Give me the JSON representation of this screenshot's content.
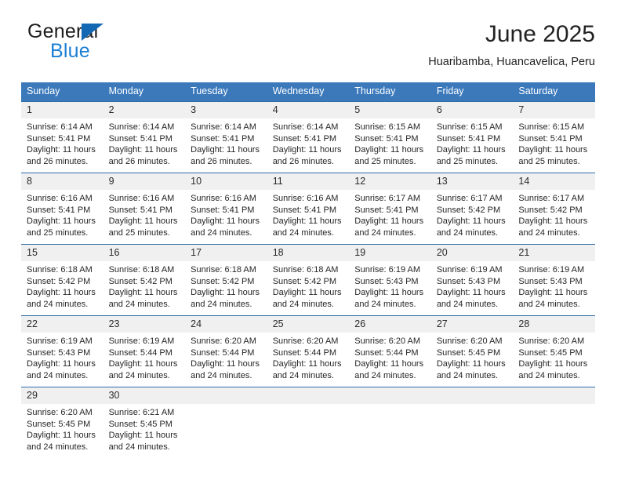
{
  "brand": {
    "name_top": "General",
    "name_bottom": "Blue",
    "triangle_color": "#1268b3",
    "blue_color": "#1b7fd4"
  },
  "header": {
    "title": "June 2025",
    "subtitle": "Huaribamba, Huancavelica, Peru"
  },
  "theme": {
    "header_bg": "#3b79bb",
    "header_text": "#ffffff",
    "daynum_bg": "#f0f0f0",
    "week_border": "#2e6da4"
  },
  "weekdays": [
    "Sunday",
    "Monday",
    "Tuesday",
    "Wednesday",
    "Thursday",
    "Friday",
    "Saturday"
  ],
  "weeks": [
    [
      {
        "day": "1",
        "sunrise": "Sunrise: 6:14 AM",
        "sunset": "Sunset: 5:41 PM",
        "daylight": "Daylight: 11 hours and 26 minutes."
      },
      {
        "day": "2",
        "sunrise": "Sunrise: 6:14 AM",
        "sunset": "Sunset: 5:41 PM",
        "daylight": "Daylight: 11 hours and 26 minutes."
      },
      {
        "day": "3",
        "sunrise": "Sunrise: 6:14 AM",
        "sunset": "Sunset: 5:41 PM",
        "daylight": "Daylight: 11 hours and 26 minutes."
      },
      {
        "day": "4",
        "sunrise": "Sunrise: 6:14 AM",
        "sunset": "Sunset: 5:41 PM",
        "daylight": "Daylight: 11 hours and 26 minutes."
      },
      {
        "day": "5",
        "sunrise": "Sunrise: 6:15 AM",
        "sunset": "Sunset: 5:41 PM",
        "daylight": "Daylight: 11 hours and 25 minutes."
      },
      {
        "day": "6",
        "sunrise": "Sunrise: 6:15 AM",
        "sunset": "Sunset: 5:41 PM",
        "daylight": "Daylight: 11 hours and 25 minutes."
      },
      {
        "day": "7",
        "sunrise": "Sunrise: 6:15 AM",
        "sunset": "Sunset: 5:41 PM",
        "daylight": "Daylight: 11 hours and 25 minutes."
      }
    ],
    [
      {
        "day": "8",
        "sunrise": "Sunrise: 6:16 AM",
        "sunset": "Sunset: 5:41 PM",
        "daylight": "Daylight: 11 hours and 25 minutes."
      },
      {
        "day": "9",
        "sunrise": "Sunrise: 6:16 AM",
        "sunset": "Sunset: 5:41 PM",
        "daylight": "Daylight: 11 hours and 25 minutes."
      },
      {
        "day": "10",
        "sunrise": "Sunrise: 6:16 AM",
        "sunset": "Sunset: 5:41 PM",
        "daylight": "Daylight: 11 hours and 24 minutes."
      },
      {
        "day": "11",
        "sunrise": "Sunrise: 6:16 AM",
        "sunset": "Sunset: 5:41 PM",
        "daylight": "Daylight: 11 hours and 24 minutes."
      },
      {
        "day": "12",
        "sunrise": "Sunrise: 6:17 AM",
        "sunset": "Sunset: 5:41 PM",
        "daylight": "Daylight: 11 hours and 24 minutes."
      },
      {
        "day": "13",
        "sunrise": "Sunrise: 6:17 AM",
        "sunset": "Sunset: 5:42 PM",
        "daylight": "Daylight: 11 hours and 24 minutes."
      },
      {
        "day": "14",
        "sunrise": "Sunrise: 6:17 AM",
        "sunset": "Sunset: 5:42 PM",
        "daylight": "Daylight: 11 hours and 24 minutes."
      }
    ],
    [
      {
        "day": "15",
        "sunrise": "Sunrise: 6:18 AM",
        "sunset": "Sunset: 5:42 PM",
        "daylight": "Daylight: 11 hours and 24 minutes."
      },
      {
        "day": "16",
        "sunrise": "Sunrise: 6:18 AM",
        "sunset": "Sunset: 5:42 PM",
        "daylight": "Daylight: 11 hours and 24 minutes."
      },
      {
        "day": "17",
        "sunrise": "Sunrise: 6:18 AM",
        "sunset": "Sunset: 5:42 PM",
        "daylight": "Daylight: 11 hours and 24 minutes."
      },
      {
        "day": "18",
        "sunrise": "Sunrise: 6:18 AM",
        "sunset": "Sunset: 5:42 PM",
        "daylight": "Daylight: 11 hours and 24 minutes."
      },
      {
        "day": "19",
        "sunrise": "Sunrise: 6:19 AM",
        "sunset": "Sunset: 5:43 PM",
        "daylight": "Daylight: 11 hours and 24 minutes."
      },
      {
        "day": "20",
        "sunrise": "Sunrise: 6:19 AM",
        "sunset": "Sunset: 5:43 PM",
        "daylight": "Daylight: 11 hours and 24 minutes."
      },
      {
        "day": "21",
        "sunrise": "Sunrise: 6:19 AM",
        "sunset": "Sunset: 5:43 PM",
        "daylight": "Daylight: 11 hours and 24 minutes."
      }
    ],
    [
      {
        "day": "22",
        "sunrise": "Sunrise: 6:19 AM",
        "sunset": "Sunset: 5:43 PM",
        "daylight": "Daylight: 11 hours and 24 minutes."
      },
      {
        "day": "23",
        "sunrise": "Sunrise: 6:19 AM",
        "sunset": "Sunset: 5:44 PM",
        "daylight": "Daylight: 11 hours and 24 minutes."
      },
      {
        "day": "24",
        "sunrise": "Sunrise: 6:20 AM",
        "sunset": "Sunset: 5:44 PM",
        "daylight": "Daylight: 11 hours and 24 minutes."
      },
      {
        "day": "25",
        "sunrise": "Sunrise: 6:20 AM",
        "sunset": "Sunset: 5:44 PM",
        "daylight": "Daylight: 11 hours and 24 minutes."
      },
      {
        "day": "26",
        "sunrise": "Sunrise: 6:20 AM",
        "sunset": "Sunset: 5:44 PM",
        "daylight": "Daylight: 11 hours and 24 minutes."
      },
      {
        "day": "27",
        "sunrise": "Sunrise: 6:20 AM",
        "sunset": "Sunset: 5:45 PM",
        "daylight": "Daylight: 11 hours and 24 minutes."
      },
      {
        "day": "28",
        "sunrise": "Sunrise: 6:20 AM",
        "sunset": "Sunset: 5:45 PM",
        "daylight": "Daylight: 11 hours and 24 minutes."
      }
    ],
    [
      {
        "day": "29",
        "sunrise": "Sunrise: 6:20 AM",
        "sunset": "Sunset: 5:45 PM",
        "daylight": "Daylight: 11 hours and 24 minutes."
      },
      {
        "day": "30",
        "sunrise": "Sunrise: 6:21 AM",
        "sunset": "Sunset: 5:45 PM",
        "daylight": "Daylight: 11 hours and 24 minutes."
      },
      {
        "day": "",
        "sunrise": "",
        "sunset": "",
        "daylight": ""
      },
      {
        "day": "",
        "sunrise": "",
        "sunset": "",
        "daylight": ""
      },
      {
        "day": "",
        "sunrise": "",
        "sunset": "",
        "daylight": ""
      },
      {
        "day": "",
        "sunrise": "",
        "sunset": "",
        "daylight": ""
      },
      {
        "day": "",
        "sunrise": "",
        "sunset": "",
        "daylight": ""
      }
    ]
  ]
}
